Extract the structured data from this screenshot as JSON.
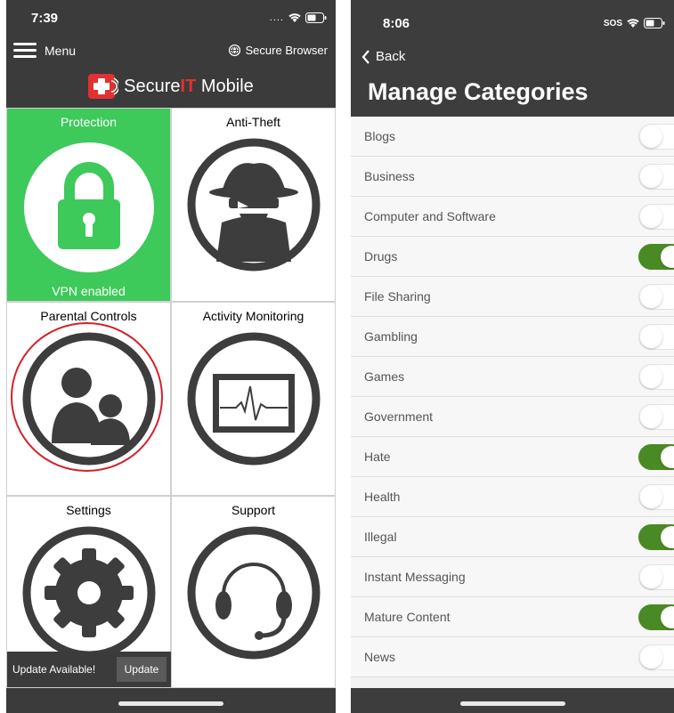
{
  "left_phone": {
    "status": {
      "time": "7:39"
    },
    "header": {
      "menu_label": "Menu",
      "secure_browser_label": "Secure Browser",
      "brand_name": "Secure",
      "brand_accent": "IT",
      "brand_suffix": " Mobile"
    },
    "tiles": [
      {
        "title": "Protection",
        "footer": "VPN enabled",
        "icon": "lock-icon"
      },
      {
        "title": "Anti-Theft",
        "icon": "spy-icon"
      },
      {
        "title": "Parental Controls",
        "icon": "parent-child-icon"
      },
      {
        "title": "Activity Monitoring",
        "icon": "heartbeat-monitor-icon"
      },
      {
        "title": "Settings",
        "icon": "gear-icon"
      },
      {
        "title": "Support",
        "icon": "headset-icon"
      }
    ],
    "update": {
      "text": "Update Available!",
      "button": "Update"
    },
    "colors": {
      "protection_green": "#3ec95b",
      "brand_red": "#e2312f",
      "highlight_red": "#d2222a"
    }
  },
  "right_phone": {
    "status": {
      "time": "8:06",
      "sos": "SOS"
    },
    "back_label": "Back",
    "title": "Manage Categories",
    "categories": [
      {
        "label": "Blogs",
        "enabled": false
      },
      {
        "label": "Business",
        "enabled": false
      },
      {
        "label": "Computer and Software",
        "enabled": false
      },
      {
        "label": "Drugs",
        "enabled": true
      },
      {
        "label": "File Sharing",
        "enabled": false
      },
      {
        "label": "Gambling",
        "enabled": false
      },
      {
        "label": "Games",
        "enabled": false
      },
      {
        "label": "Government",
        "enabled": false
      },
      {
        "label": "Hate",
        "enabled": true
      },
      {
        "label": "Health",
        "enabled": false
      },
      {
        "label": "Illegal",
        "enabled": true
      },
      {
        "label": "Instant Messaging",
        "enabled": false
      },
      {
        "label": "Mature Content",
        "enabled": true
      },
      {
        "label": "News",
        "enabled": false
      }
    ],
    "colors": {
      "toggle_on": "#4a8a25"
    }
  }
}
